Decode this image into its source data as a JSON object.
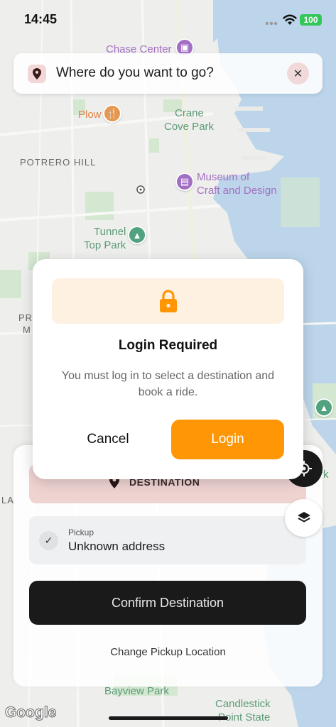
{
  "status_bar": {
    "time": "14:45",
    "battery": "100"
  },
  "search": {
    "text": "Where do you want to go?",
    "pin_icon": "map-pin-icon",
    "clear_icon": "close-icon"
  },
  "map": {
    "labels": {
      "chase_center": "Chase Center",
      "plow": "Plow",
      "crane_cove_1": "Crane",
      "crane_cove_2": "Cove Park",
      "potrero_hill": "POTRERO HILL",
      "museum_1": "Museum of",
      "museum_2": "Craft and Design",
      "tunnel_1": "Tunnel",
      "tunnel_2": "Top Park",
      "pr": "PR",
      "m": "M",
      "la": "LA",
      "rk": "rk",
      "bayview": "Bayview Park",
      "candlestick_1": "Candlestick",
      "candlestick_2": "Point State"
    },
    "google": "Google"
  },
  "sheet": {
    "destination_label": "DESTINATION",
    "pickup_caption": "Pickup",
    "pickup_address": "Unknown address",
    "confirm_label": "Confirm Destination",
    "change_pickup_label": "Change Pickup Location"
  },
  "modal": {
    "icon": "lock-icon",
    "title": "Login Required",
    "message": "You must log in to select a destination and book a ride.",
    "cancel_label": "Cancel",
    "login_label": "Login"
  },
  "colors": {
    "accent": "#ff9605",
    "destination_bg": "#efd3d1",
    "confirm_bg": "#1a1a1a",
    "battery": "#33c759"
  }
}
